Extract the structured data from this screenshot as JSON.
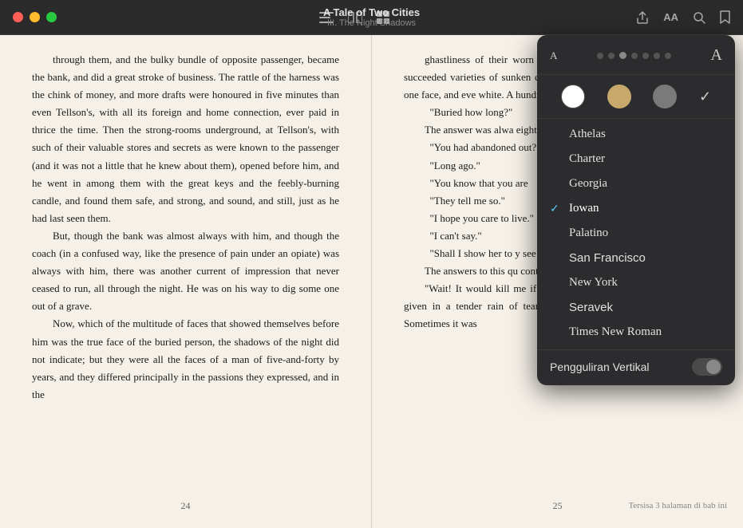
{
  "titlebar": {
    "title": "A Tale of Two Cities",
    "subtitle": "III. The Night Shadows"
  },
  "page_left": {
    "number": "24",
    "paragraphs": [
      "them, and the bulky bundle of opposite passenger, became the bank, and did a great stroke of business. The rattle of the harness was the chink of money, and more drafts were honoured in five minutes than even Tellson's, with all its foreign and home connection, ever paid in thrice the time. Then the strong-rooms underground, at Tellson's, with such of their valuable stores and secrets as were known to the passenger (and it was not a little that he knew about them), opened before him, and he went in among them with the great keys and the feebly-burning candle, and found them safe, and strong, and sound, and still, just as he had last seen them.",
      "But, though the bank was almost always with him, and though the coach (in a confused way, like the presence of pain under an opiate) was always with him, there was another current of impression that never ceased to run, all through the night. He was on his way to dig some one out of a grave.",
      "Now, which of the multitude of faces that showed themselves before him was the true face of the buried person, the shadows of the night did not indicate; but they were all the faces of a man of five-and-forty by years, and they differed principally in the passions they expressed, and in the"
    ]
  },
  "page_right": {
    "number": "25",
    "status": "Tersisa 3 halaman di bab ini",
    "paragraphs": [
      "ghastliness of their worn a contempt, defiance, stub lamentation, succeeded varieties of sunken chee emaciated hands and figur the main one face, and eve white. A hundred times inquired of this spectre:",
      "\"Buried how long?\"",
      "The answer was alwa eighteen years.\"",
      "\"You had abandoned out?\"",
      "\"Long ago.\"",
      "\"You know that you are",
      "\"They tell me so.\"",
      "\"I hope you care to live.\"",
      "\"I can't say.\"",
      "\"Shall I show her to y see her?\"",
      "The answers to this qu contradictory. Sometimes",
      "\"Wait! It would kill me if I saw her too soon.\" Sometimes, it was given in a tender rain of tears, and then it was, \"Take me to her.\" Sometimes it was"
    ]
  },
  "dropdown": {
    "font_size_small": "A",
    "font_size_large": "A",
    "themes": [
      {
        "color": "#ffffff",
        "label": "white",
        "selected": false
      },
      {
        "color": "#e8d5a0",
        "label": "sepia",
        "selected": false
      },
      {
        "color": "#7a7a7a",
        "label": "gray",
        "selected": false
      },
      {
        "color": "#1a1a2e",
        "label": "dark",
        "selected": true
      }
    ],
    "fonts": [
      {
        "name": "Athelas",
        "selected": false
      },
      {
        "name": "Charter",
        "selected": false
      },
      {
        "name": "Georgia",
        "selected": false
      },
      {
        "name": "Iowan",
        "selected": true
      },
      {
        "name": "Palatino",
        "selected": false
      },
      {
        "name": "San Francisco",
        "selected": false
      },
      {
        "name": "New York",
        "selected": false
      },
      {
        "name": "Seravek",
        "selected": false
      },
      {
        "name": "Times New Roman",
        "selected": false
      }
    ],
    "vertical_scroll_label": "Pengguliran Vertikal"
  }
}
